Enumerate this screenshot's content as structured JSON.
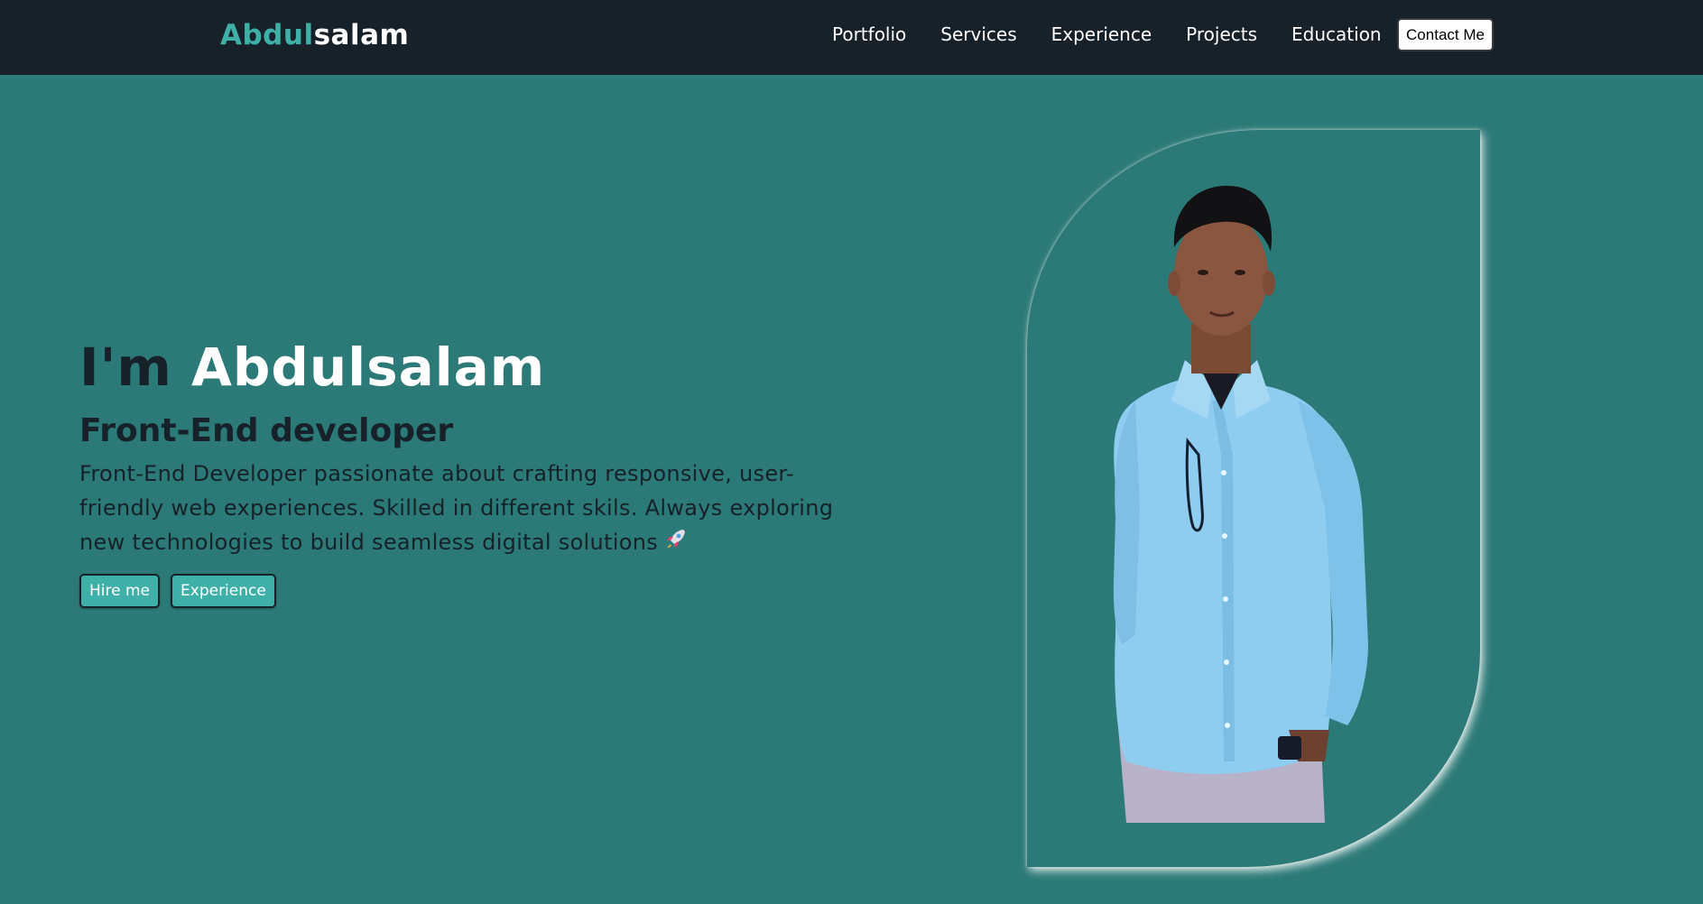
{
  "brand": {
    "first": "Abdul",
    "second": "salam"
  },
  "nav": {
    "links": [
      "Portfolio",
      "Services",
      "Experience",
      "Projects",
      "Education"
    ],
    "contact_label": "Contact Me"
  },
  "hero": {
    "greeting": "I'm",
    "name": "Abdulsalam",
    "role": "Front-End developer",
    "description": "Front-End Developer passionate about crafting responsive, user-friendly web experiences. Skilled in different skils. Always exploring new technologies to build seamless digital solutions",
    "buttons": {
      "hire": "Hire me",
      "experience": "Experience"
    }
  },
  "colors": {
    "background": "#2c7a77",
    "navbar": "#162129",
    "accent": "#3fb0a8",
    "text_dark": "#162129",
    "text_light": "#ffffff"
  },
  "icons": {
    "rocket": "rocket-icon"
  }
}
